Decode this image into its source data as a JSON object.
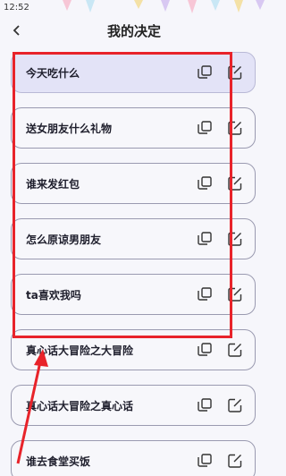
{
  "status": {
    "time": "12:52"
  },
  "header": {
    "title": "我的决定"
  },
  "decisions": [
    {
      "title": "今天吃什么",
      "highlight": true
    },
    {
      "title": "送女朋友什么礼物",
      "highlight": false
    },
    {
      "title": "谁来发红包",
      "highlight": false
    },
    {
      "title": "怎么原谅男朋友",
      "highlight": false
    },
    {
      "title": "ta喜欢我吗",
      "highlight": false
    },
    {
      "title": "真心话大冒险之大冒险",
      "highlight": false
    },
    {
      "title": "真心话大冒险之真心话",
      "highlight": false
    },
    {
      "title": "谁去食堂买饭",
      "highlight": false
    }
  ],
  "colors": {
    "accent_red": "#e8232a",
    "highlight_bg": "#e3e3f7"
  },
  "icons": {
    "back": "chevron-left-icon",
    "copy": "copy-icon",
    "edit": "edit-icon"
  }
}
